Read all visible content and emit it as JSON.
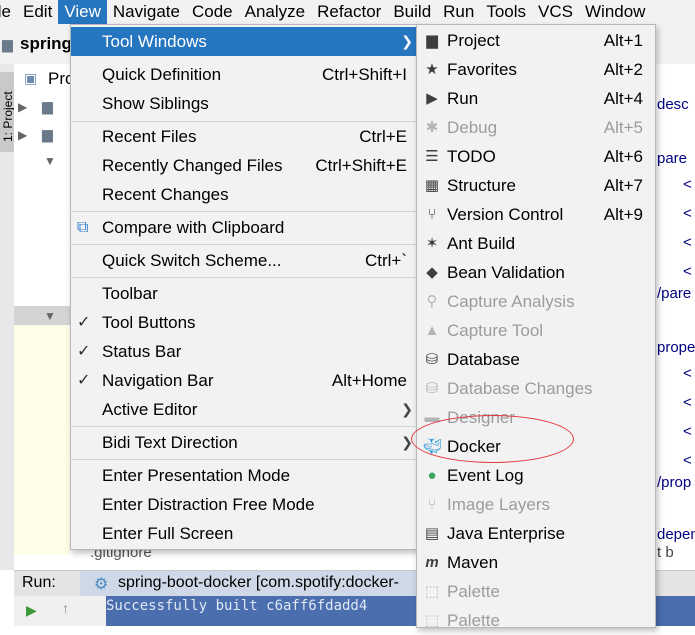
{
  "menubar": {
    "items": [
      "ile",
      "Edit",
      "View",
      "Navigate",
      "Code",
      "Analyze",
      "Refactor",
      "Build",
      "Run",
      "Tools",
      "VCS",
      "Window"
    ]
  },
  "background": {
    "toolbar_text": "spring",
    "project_tab": "1: Project",
    "panel_label": "Pro",
    "gitignore": ".gitignore",
    "run_label": "Run:",
    "run_config": "spring-boot-docker [com.spotify:docker-",
    "console_line": "Successfully built c6aff6fdadd4",
    "code_tokens": [
      "desc",
      "pare",
      "/pare",
      "prope",
      "/prop",
      "depen",
      "t  b"
    ]
  },
  "view_menu": {
    "items": [
      {
        "label": "Tool Windows",
        "shortcut": "",
        "submenu": true,
        "selected": true
      },
      {
        "label": "Quick Definition",
        "shortcut": "Ctrl+Shift+I"
      },
      {
        "label": "Show Siblings",
        "shortcut": ""
      },
      {
        "label": "Recent Files",
        "shortcut": "Ctrl+E"
      },
      {
        "label": "Recently Changed Files",
        "shortcut": "Ctrl+Shift+E"
      },
      {
        "label": "Recent Changes",
        "shortcut": ""
      },
      {
        "label": "Compare with Clipboard",
        "shortcut": ""
      },
      {
        "label": "Quick Switch Scheme...",
        "shortcut": "Ctrl+`"
      },
      {
        "label": "Toolbar",
        "shortcut": ""
      },
      {
        "label": "Tool Buttons",
        "shortcut": "",
        "checked": true
      },
      {
        "label": "Status Bar",
        "shortcut": "",
        "checked": true
      },
      {
        "label": "Navigation Bar",
        "shortcut": "Alt+Home",
        "checked": true
      },
      {
        "label": "Active Editor",
        "shortcut": "",
        "submenu": true
      },
      {
        "label": "Bidi Text Direction",
        "shortcut": "",
        "submenu": true
      },
      {
        "label": "Enter Presentation Mode",
        "shortcut": ""
      },
      {
        "label": "Enter Distraction Free Mode",
        "shortcut": ""
      },
      {
        "label": "Enter Full Screen",
        "shortcut": ""
      }
    ]
  },
  "tool_windows_menu": {
    "items": [
      {
        "label": "Project",
        "shortcut": "Alt+1",
        "icon": "folder-icon"
      },
      {
        "label": "Favorites",
        "shortcut": "Alt+2",
        "icon": "star-icon"
      },
      {
        "label": "Run",
        "shortcut": "Alt+4",
        "icon": "play-icon"
      },
      {
        "label": "Debug",
        "shortcut": "Alt+5",
        "icon": "bug-icon",
        "disabled": true
      },
      {
        "label": "TODO",
        "shortcut": "Alt+6",
        "icon": "list-icon"
      },
      {
        "label": "Structure",
        "shortcut": "Alt+7",
        "icon": "structure-icon"
      },
      {
        "label": "Version Control",
        "shortcut": "Alt+9",
        "icon": "branch-icon"
      },
      {
        "label": "Ant Build",
        "shortcut": "",
        "icon": "ant-icon"
      },
      {
        "label": "Bean Validation",
        "shortcut": "",
        "icon": "bean-icon"
      },
      {
        "label": "Capture Analysis",
        "shortcut": "",
        "icon": "magnifier-icon",
        "disabled": true
      },
      {
        "label": "Capture Tool",
        "shortcut": "",
        "icon": "warning-icon",
        "disabled": true
      },
      {
        "label": "Database",
        "shortcut": "",
        "icon": "database-icon"
      },
      {
        "label": "Database Changes",
        "shortcut": "",
        "icon": "database-changes-icon",
        "disabled": true
      },
      {
        "label": "Designer",
        "shortcut": "",
        "icon": "designer-icon",
        "disabled": true
      },
      {
        "label": "Docker",
        "shortcut": "",
        "icon": "docker-icon"
      },
      {
        "label": "Event Log",
        "shortcut": "",
        "icon": "event-log-icon"
      },
      {
        "label": "Image Layers",
        "shortcut": "",
        "icon": "image-layers-icon",
        "disabled": true
      },
      {
        "label": "Java Enterprise",
        "shortcut": "",
        "icon": "java-enterprise-icon"
      },
      {
        "label": "Maven",
        "shortcut": "",
        "icon": "maven-icon"
      },
      {
        "label": "Palette",
        "shortcut": "",
        "icon": "palette-icon",
        "disabled": true
      },
      {
        "label": "Palette",
        "shortcut": "",
        "icon": "palette-icon",
        "disabled": true
      }
    ]
  },
  "colors": {
    "selection": "#2675bf",
    "menu_bg": "#f2f2f2",
    "annotation": "#e0383e",
    "console_bg": "#4b6eaf"
  }
}
